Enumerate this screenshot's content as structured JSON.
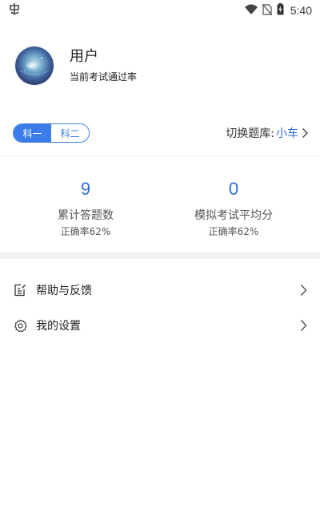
{
  "status_bar": {
    "time": "5:40",
    "app_icon": "bug-icon",
    "icons": [
      "wifi-icon",
      "no-sim-icon",
      "battery-charging-icon"
    ]
  },
  "profile": {
    "name": "用户",
    "subtitle": "当前考试通过率"
  },
  "subjects": {
    "tabs": [
      {
        "label": "科一",
        "active": true
      },
      {
        "label": "科二",
        "active": false
      }
    ],
    "bank_label": "切换题库:",
    "bank_value": "小车"
  },
  "stats": [
    {
      "value": "9",
      "label": "累计答题数",
      "sub": "正确率62%"
    },
    {
      "value": "0",
      "label": "模拟考试平均分",
      "sub": "正确率62%"
    }
  ],
  "menu": [
    {
      "label": "帮助与反馈",
      "icon": "feedback-icon"
    },
    {
      "label": "我的设置",
      "icon": "settings-gear-icon"
    }
  ],
  "colors": {
    "accent": "#3a7de8",
    "accent_text": "#2f6fd6",
    "divider": "#f2f2f2"
  }
}
